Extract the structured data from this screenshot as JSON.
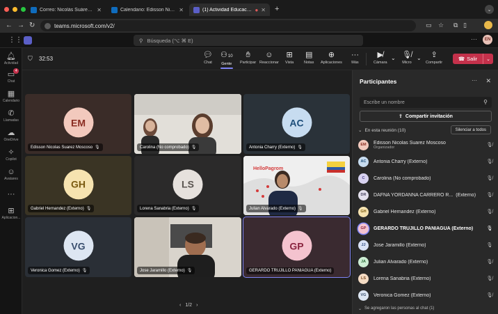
{
  "browser": {
    "tabs": [
      {
        "title": "Correo: Nicolás Suárez - Outl",
        "favicon_color": "#0f6cbd"
      },
      {
        "title": "Calendario: Edisson Nicolas S",
        "favicon_color": "#0f6cbd"
      },
      {
        "title": "(1) Actividad Educación A",
        "favicon_color": "#5b5fc7"
      }
    ],
    "new_tab": "+",
    "url": "teams.microsoft.com/v2/"
  },
  "teams": {
    "search_placeholder": "Búsqueda (⌥ ⌘ E)",
    "me_initials": "EN",
    "rail": [
      {
        "label": "Actividad",
        "icon": "bell-icon"
      },
      {
        "label": "Chat",
        "icon": "chat-icon",
        "badge": "4"
      },
      {
        "label": "Calendario",
        "icon": "calendar-icon"
      },
      {
        "label": "Llamadas",
        "icon": "phone-icon"
      },
      {
        "label": "OneDrive",
        "icon": "cloud-icon"
      },
      {
        "label": "Copilot",
        "icon": "copilot-icon"
      },
      {
        "label": "Avatares",
        "icon": "avatar-icon"
      },
      {
        "label": "",
        "icon": "more-icon"
      },
      {
        "label": "Aplicacion...",
        "icon": "apps-icon"
      }
    ]
  },
  "meeting": {
    "timer": "32:53",
    "toolbar": [
      {
        "label": "Chat",
        "icon": "chat-icon"
      },
      {
        "label": "Gente",
        "icon": "people-icon",
        "count": "10",
        "active": true
      },
      {
        "label": "Participar",
        "icon": "raise-hand-icon"
      },
      {
        "label": "Reaccionar",
        "icon": "reaction-icon"
      },
      {
        "label": "Vista",
        "icon": "view-icon"
      },
      {
        "label": "Notas",
        "icon": "notes-icon"
      },
      {
        "label": "Aplicaciones",
        "icon": "add-apps-icon"
      },
      {
        "label": "Más",
        "icon": "more-icon"
      },
      {
        "label": "Cámara",
        "icon": "camera-off-icon"
      },
      {
        "label": "Micro",
        "icon": "mic-off-icon"
      },
      {
        "label": "Compartir",
        "icon": "share-icon"
      }
    ],
    "leave_label": "Salir",
    "pager": {
      "prev": "‹",
      "label": "1/2",
      "next": "›"
    },
    "tiles": [
      {
        "name": "Edisson Nicolas Suarez Moscoso",
        "initials": "EM",
        "bg": "#3a2c28",
        "avatar_bg": "#f2c9bd",
        "avatar_fg": "#8a2d22",
        "video": false
      },
      {
        "name": "Carolina (No comprobado)",
        "initials": "",
        "bg": "#d9d6d0",
        "video": true,
        "kind": "two-women"
      },
      {
        "name": "Antonia Charry (Externo)",
        "initials": "AC",
        "bg": "#2a3239",
        "avatar_bg": "#c7dcf0",
        "avatar_fg": "#1d4e7a",
        "video": false
      },
      {
        "name": "Gabriel Hernandez (Externo)",
        "initials": "GH",
        "bg": "#3a3424",
        "avatar_bg": "#f6e3b0",
        "avatar_fg": "#7a5a10",
        "video": false
      },
      {
        "name": "Lorena Sanabria (Externo)",
        "initials": "LS",
        "bg": "#2b2a2a",
        "avatar_bg": "#e6e1dd",
        "avatar_fg": "#5a5450",
        "video": false
      },
      {
        "name": "Julian Alvarado (Externo)",
        "initials": "",
        "bg": "#eaeaea",
        "video": true,
        "kind": "man-map"
      },
      {
        "name": "Veronica Gomez (Externo)",
        "initials": "VG",
        "bg": "#2a2f36",
        "avatar_bg": "#dde6f2",
        "avatar_fg": "#3a4f6e",
        "video": false
      },
      {
        "name": "Jose Jaramillo (Externo)",
        "initials": "",
        "bg": "#9a9590",
        "video": true,
        "kind": "man-room"
      },
      {
        "name": "GERARDO TRUJILLO PANIAGUA (Externo)",
        "initials": "GP",
        "bg": "#3a2a30",
        "avatar_bg": "#f4c3cf",
        "avatar_fg": "#8a2540",
        "video": false,
        "speaking": true
      }
    ]
  },
  "participants": {
    "title": "Participantes",
    "search_placeholder": "Escribe un nombre",
    "share_label": "Compartir invitación",
    "section_label": "En esta reunión (10)",
    "mute_all_label": "Silenciar a todos",
    "list": [
      {
        "initials": "EM",
        "name": "Edisson Nicolas Suarez Moscoso",
        "role": "Organizador",
        "bg": "#f2c9bd",
        "fg": "#8a2d22",
        "mic": "off"
      },
      {
        "initials": "AC",
        "name": "Antonia Charry (Externo)",
        "role": "",
        "bg": "#c7dcf0",
        "fg": "#1d4e7a",
        "mic": "off"
      },
      {
        "initials": "C",
        "name": "Carolina (No comprobado)",
        "role": "",
        "bg": "#d8d2f0",
        "fg": "#4b3f8a",
        "mic": "off"
      },
      {
        "initials": "DR",
        "name": "DAFNA YORDANNA CARRERO R...",
        "tag": "(Externo)",
        "role": "",
        "bg": "#e3e0ec",
        "fg": "#4a4560",
        "mic": "off"
      },
      {
        "initials": "GH",
        "name": "Gabriel Hernandez (Externo)",
        "role": "",
        "bg": "#f6e3b0",
        "fg": "#7a5a10",
        "mic": "off"
      },
      {
        "initials": "GP",
        "name": "GERARDO TRUJILLO PANIAGUA (Externo)",
        "role": "",
        "bg": "#f4c3cf",
        "fg": "#8a2540",
        "mic": "on",
        "bold": true,
        "ring": true
      },
      {
        "initials": "JJ",
        "name": "Jose Jaramillo (Externo)",
        "role": "",
        "bg": "#d9e2f5",
        "fg": "#2e4a80",
        "mic": "on"
      },
      {
        "initials": "JA",
        "name": "Julian Alvarado (Externo)",
        "role": "",
        "bg": "#cdeed4",
        "fg": "#2a6a38",
        "mic": "off"
      },
      {
        "initials": "LS",
        "name": "Lorena Sanabria (Externo)",
        "role": "",
        "bg": "#f5dcc4",
        "fg": "#7a4a20",
        "mic": "off"
      },
      {
        "initials": "VG",
        "name": "Veronica Gomez (Externo)",
        "role": "",
        "bg": "#dde6f2",
        "fg": "#3a4f6e",
        "mic": "off"
      }
    ],
    "footer_label": "Se agregaron las personas al chat (1)"
  }
}
